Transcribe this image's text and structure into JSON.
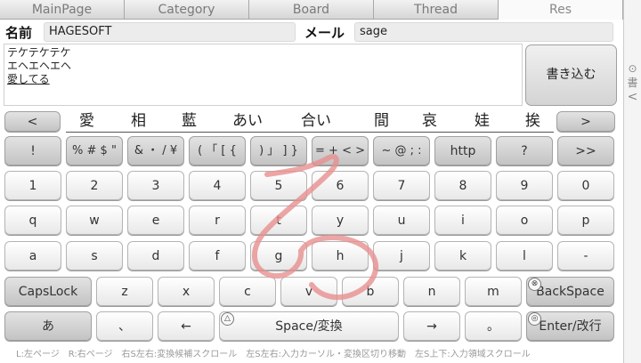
{
  "tabs": [
    "MainPage",
    "Category",
    "Board",
    "Thread",
    "Res"
  ],
  "active_tab": "Res",
  "form": {
    "name_label": "名前",
    "name_value": "HAGESOFT",
    "mail_label": "メール",
    "mail_value": "sage",
    "message_lines": [
      "テケテケテケ",
      "エヘエヘエヘ",
      "愛してる"
    ],
    "submit_label": "書き込む"
  },
  "candidates": {
    "prev": "<",
    "next": ">",
    "items": [
      "愛",
      "相",
      "藍",
      "あい",
      "合い",
      "間",
      "哀",
      "娃",
      "挨"
    ]
  },
  "keyboard": {
    "symbols": [
      "!",
      "% # $ \"",
      "& ・ / ¥",
      "( 「 [ {",
      ") 」 ] }",
      "= + < >",
      "~ @ ; :",
      "http",
      "?",
      ">>"
    ],
    "digits": [
      "1",
      "2",
      "3",
      "4",
      "5",
      "6",
      "7",
      "8",
      "9",
      "0"
    ],
    "row_q": [
      "q",
      "w",
      "e",
      "r",
      "t",
      "y",
      "u",
      "i",
      "o",
      "p"
    ],
    "row_a": [
      "a",
      "s",
      "d",
      "f",
      "g",
      "h",
      "j",
      "k",
      "l",
      "-"
    ],
    "capslock": "CapsLock",
    "row_z": [
      "z",
      "x",
      "c",
      "v",
      "b",
      "n",
      "m"
    ],
    "backspace": "BackSpace",
    "kana": "あ",
    "comma": "、",
    "left_arrow": "←",
    "space": "Space/変換",
    "right_arrow": "→",
    "period": "。",
    "enter": "Enter/改行",
    "overlay_backspace": "⊗",
    "overlay_space": "△",
    "overlay_enter": "◎"
  },
  "footer": "L:左ページ　R:右ページ　右S左右:変換候補スクロール　左S左右:入力カーソル・変換区切り移動　左S上下:入力領域スクロール",
  "side": {
    "top_icon": "⊙",
    "label": "書",
    "arrow": "<"
  },
  "colors": {
    "gesture_stroke": "#e89090"
  }
}
